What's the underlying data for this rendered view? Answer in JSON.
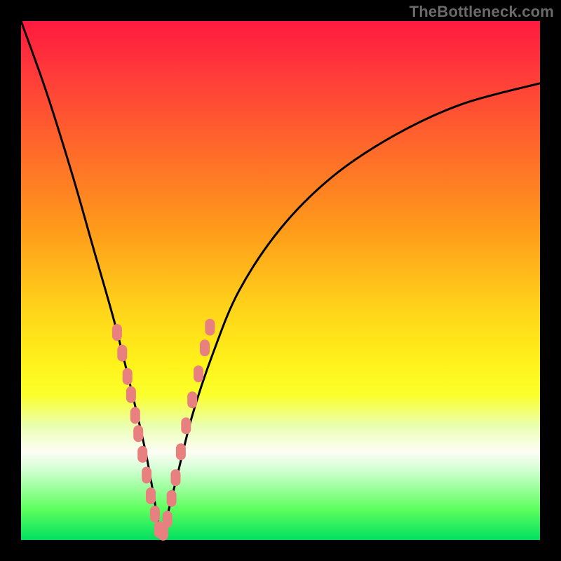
{
  "watermark": "TheBottleneck.com",
  "colors": {
    "frame": "#000000",
    "curve": "#000000",
    "marker": "#e98080",
    "gradient_stops": [
      "#ff1a3f",
      "#ff3a3a",
      "#ff6a2a",
      "#ff9a1a",
      "#ffd21a",
      "#fff21a",
      "#fbff2a",
      "#eaffb0",
      "#fdfdf5",
      "#d8ffd8",
      "#9cff9c",
      "#5eff5e",
      "#00e060"
    ]
  },
  "chart_data": {
    "type": "line",
    "title": "",
    "xlabel": "",
    "ylabel": "",
    "xlim": [
      0,
      100
    ],
    "ylim": [
      0,
      100
    ],
    "notes": "V-shaped bottleneck curve. y ≈ |x − 27| rescaled; minimum (optimal match) near x ≈ 27. Background gradient encodes mismatch severity: green (bottom) = good, red (top) = severe bottleneck.",
    "series": [
      {
        "name": "bottleneck-curve",
        "x": [
          0,
          5,
          10,
          14,
          18,
          21,
          24,
          26,
          27,
          28,
          30,
          33,
          37,
          42,
          50,
          60,
          72,
          85,
          100
        ],
        "y": [
          100,
          86,
          70,
          56,
          42,
          30,
          17,
          6,
          1,
          4,
          12,
          24,
          36,
          48,
          60,
          70,
          78,
          84,
          88
        ]
      }
    ],
    "markers": {
      "name": "highlighted-points",
      "x": [
        18.5,
        19.5,
        20.5,
        21.2,
        22.0,
        22.6,
        23.4,
        24.2,
        25.0,
        25.8,
        26.6,
        27.4,
        28.2,
        29.0,
        29.8,
        30.8,
        31.8,
        33.0,
        34.2,
        35.4,
        36.4
      ],
      "y": [
        40.0,
        36.0,
        31.5,
        28.0,
        24.0,
        20.5,
        16.5,
        12.5,
        8.5,
        5.0,
        2.0,
        1.5,
        4.0,
        8.0,
        12.0,
        17.0,
        22.0,
        27.0,
        32.0,
        37.0,
        41.0
      ]
    }
  }
}
